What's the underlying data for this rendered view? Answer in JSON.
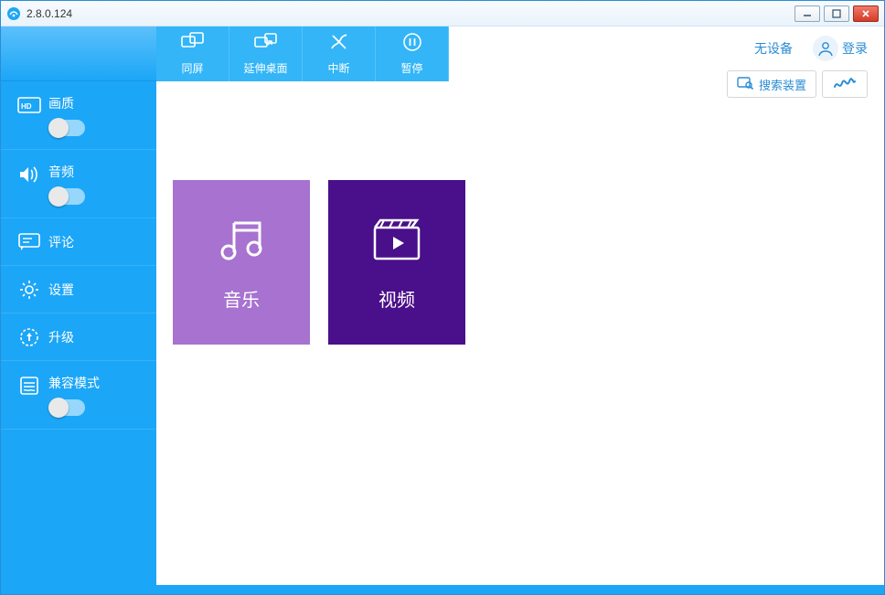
{
  "window": {
    "title": "2.8.0.124"
  },
  "toolbar": {
    "mirror": "同屏",
    "extend": "延伸桌面",
    "interrupt": "中断",
    "pause": "暂停"
  },
  "sidebar": {
    "quality": "画质",
    "audio": "音频",
    "comment": "评论",
    "settings": "设置",
    "upgrade": "升级",
    "compat": "兼容模式"
  },
  "topright": {
    "no_device": "无设备",
    "login": "登录",
    "search_device": "搜索装置"
  },
  "tiles": {
    "music": "音乐",
    "video": "视频"
  }
}
